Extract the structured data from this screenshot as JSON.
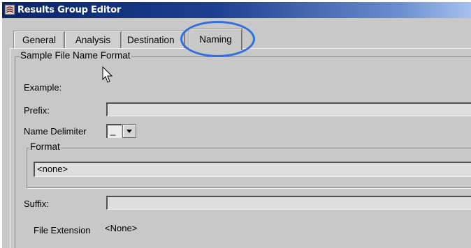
{
  "window": {
    "title": "Results Group Editor"
  },
  "tabs": [
    {
      "label": "General"
    },
    {
      "label": "Analysis"
    },
    {
      "label": "Destination"
    },
    {
      "label": "Naming",
      "active": true
    }
  ],
  "sample_file_name_format": {
    "title": "Sample File Name Format",
    "example_label": "Example:",
    "prefix_label": "Prefix:",
    "prefix_value": "",
    "name_delimiter_label": "Name Delimiter",
    "name_delimiter_value": "_",
    "format": {
      "title": "Format",
      "value": "<none>"
    },
    "suffix_label": "Suffix:",
    "suffix_value": "",
    "file_extension_label": "File Extension",
    "file_extension_value": "<None>"
  },
  "colors": {
    "title_bar": "#0a246a",
    "window_bg": "#c8c8c8",
    "highlight_circle": "#2f6fe0"
  }
}
